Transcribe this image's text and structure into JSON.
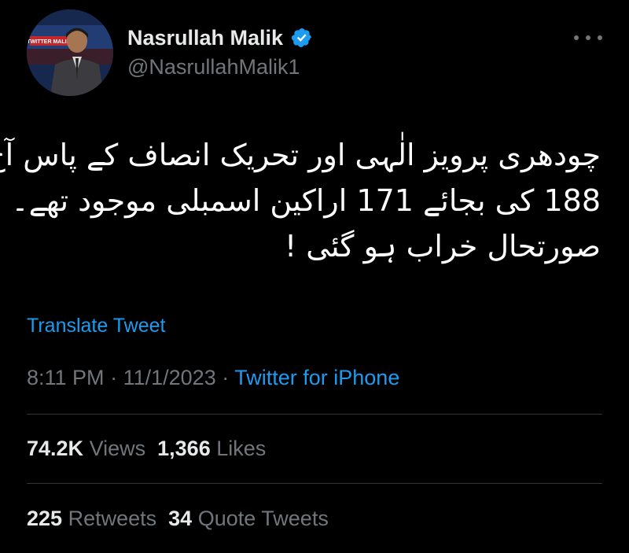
{
  "author": {
    "display_name": "Nasrullah Malik",
    "handle": "@NasrullahMalik1",
    "verified_icon": "verified-badge-icon",
    "avatar_overlay_text": "TWITTER MALIK"
  },
  "tweet": {
    "text_lines": [
      "چودھری پرویز الٰہی اور تحریک انصاف کے پاس آج",
      "188 کی بجائے 171 اراکین اسمبلی موجود تھے۔",
      "صورتحال خراب ہو گئی !"
    ],
    "translate_label": "Translate Tweet",
    "time": "8:11 PM",
    "date": "11/1/2023",
    "separator": "·",
    "source": "Twitter for iPhone"
  },
  "stats": {
    "views_count": "74.2K",
    "views_label": "Views",
    "likes_count": "1,366",
    "likes_label": "Likes",
    "retweets_count": "225",
    "retweets_label": "Retweets",
    "quotes_count": "34",
    "quotes_label": "Quote Tweets"
  },
  "colors": {
    "background": "#000000",
    "text_primary": "#e7e9ea",
    "text_secondary": "#71767b",
    "accent": "#1d9bf0",
    "divider": "#2f3336"
  }
}
